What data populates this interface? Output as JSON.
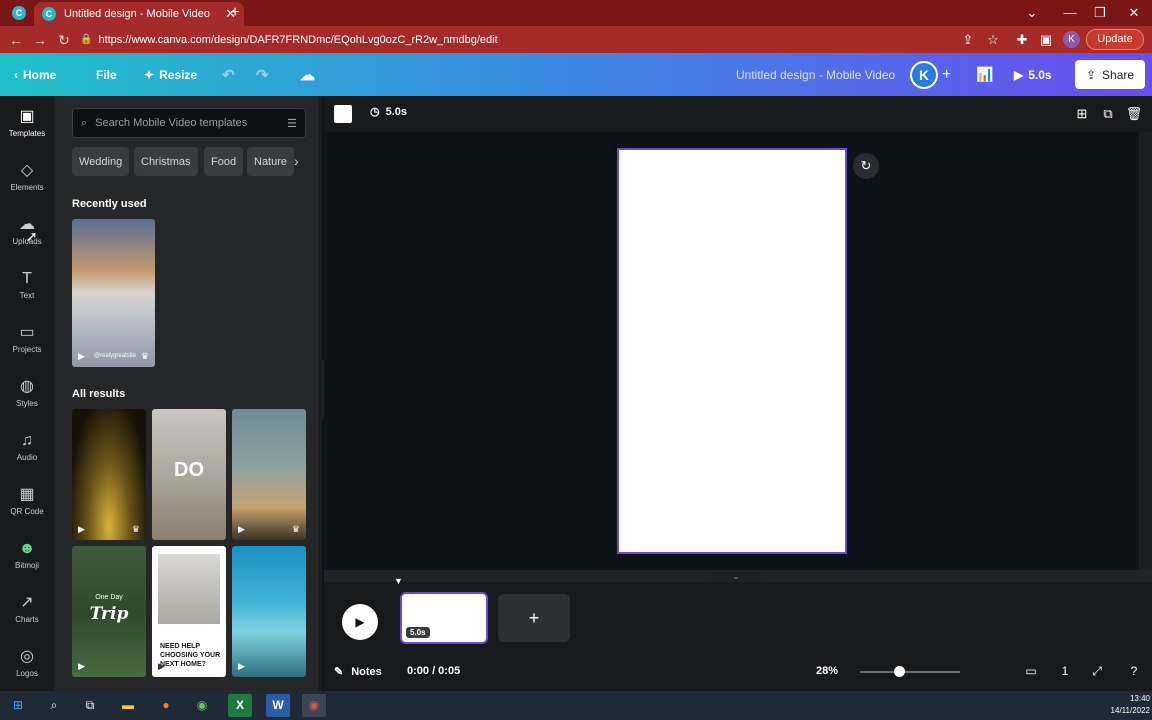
{
  "browser": {
    "tab_title": "Untitled design - Mobile Video",
    "url": "https://www.canva.com/design/DAFR7FRNDmc/EQohLvg0ozC_rR2w_nmdbg/edit",
    "profile_initial": "K",
    "update_label": "Update",
    "accent_color": "#a52a2a"
  },
  "header": {
    "home_label": "Home",
    "file_label": "File",
    "resize_label": "Resize",
    "doc_title": "Untitled design - Mobile Video",
    "avatar_initial": "K",
    "play_duration": "5.0s",
    "share_label": "Share"
  },
  "leftnav": {
    "items": [
      {
        "label": "Templates",
        "icon": "templates-icon"
      },
      {
        "label": "Elements",
        "icon": "elements-icon"
      },
      {
        "label": "Uploads",
        "icon": "uploads-icon"
      },
      {
        "label": "Text",
        "icon": "text-icon"
      },
      {
        "label": "Projects",
        "icon": "folder-icon"
      },
      {
        "label": "Styles",
        "icon": "palette-icon"
      },
      {
        "label": "Audio",
        "icon": "music-icon"
      },
      {
        "label": "QR Code",
        "icon": "qr-icon"
      },
      {
        "label": "Bitmoji",
        "icon": "bitmoji-icon"
      },
      {
        "label": "Charts",
        "icon": "chart-icon"
      },
      {
        "label": "Logos",
        "icon": "logo-icon"
      }
    ]
  },
  "panel": {
    "search_placeholder": "Search Mobile Video templates",
    "chips": [
      "Wedding",
      "Christmas",
      "Food",
      "Nature"
    ],
    "recently_used_title": "Recently used",
    "recent_caption": "@realygreatsite",
    "all_results_title": "All results",
    "result_big_text": "DO",
    "result_trip_small": "One Day",
    "result_trip_big": "Trip",
    "result_home_text": "NEED HELP CHOOSING YOUR NEXT HOME?"
  },
  "editor": {
    "duration": "5.0s",
    "clip_badge": "5.0s",
    "time_display": "0:00 / 0:05",
    "notes_label": "Notes",
    "zoom": "28%",
    "page_number": "1",
    "selection_color": "#6f4ad8"
  },
  "taskbar": {
    "time": "13:40",
    "date": "14/11/2022"
  }
}
